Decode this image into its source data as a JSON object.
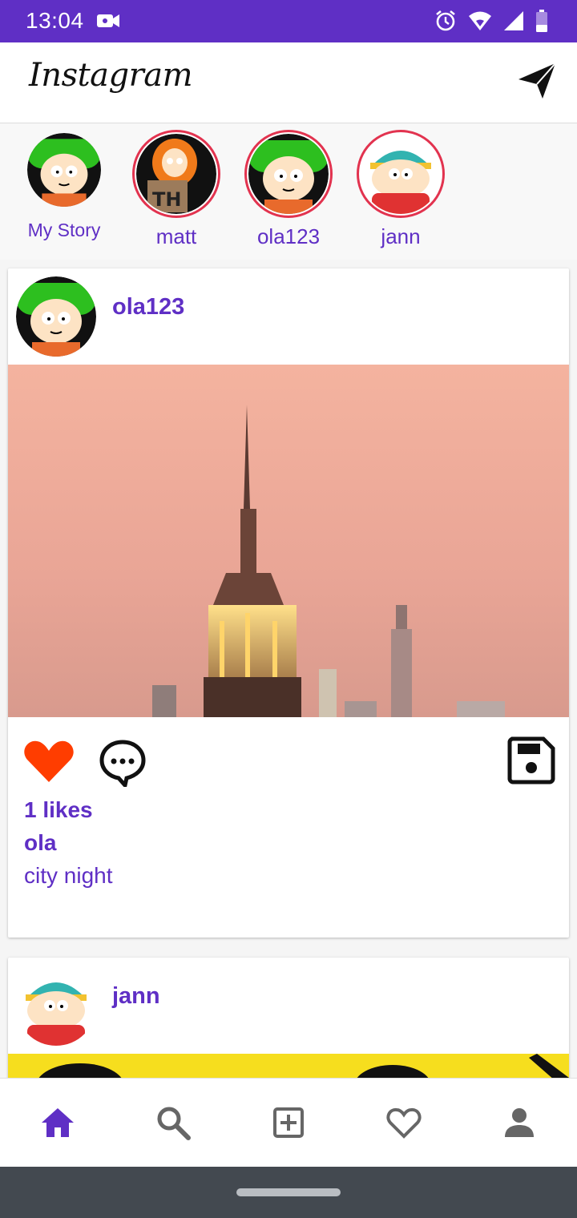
{
  "statusbar": {
    "time": "13:04"
  },
  "header": {
    "logo_text": "Instagram"
  },
  "stories": [
    {
      "label": "My Story",
      "avatar": "kyle"
    },
    {
      "label": "matt",
      "avatar": "kenny"
    },
    {
      "label": "ola123",
      "avatar": "kyle"
    },
    {
      "label": "jann",
      "avatar": "cartman"
    }
  ],
  "posts": [
    {
      "username": "ola123",
      "avatar": "kyle",
      "image": "city-night-skyline",
      "likes": "1 likes",
      "owner": "ola",
      "caption": "city night"
    },
    {
      "username": "jann",
      "avatar": "cartman",
      "image": "yellow-photo"
    }
  ],
  "bottom_nav": [
    "home-icon",
    "search-icon",
    "add-post-icon",
    "heart-outline-icon",
    "profile-icon"
  ],
  "colors": {
    "accent": "#5f2fc5",
    "story_ring": "#e2334f",
    "like": "#ff3d00"
  }
}
